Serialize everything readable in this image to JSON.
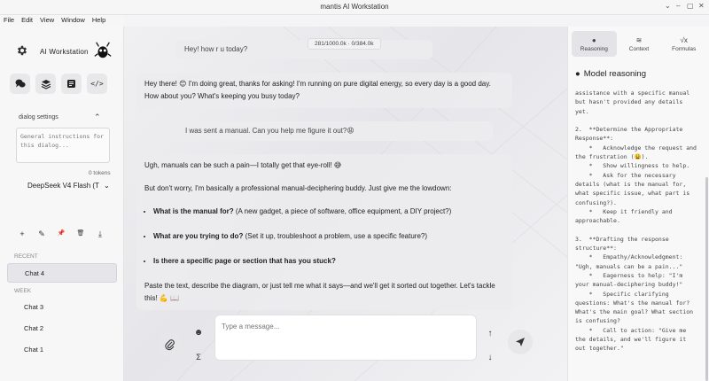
{
  "window": {
    "title": "mantis AI Workstation",
    "controls": [
      "⌄",
      "–",
      "▢",
      "✕"
    ]
  },
  "menu": [
    "File",
    "Edit",
    "View",
    "Window",
    "Help"
  ],
  "sidebar": {
    "brand": "AI Workstation",
    "mode_buttons": [
      {
        "name": "chat-mode-button",
        "glyph": "💬"
      },
      {
        "name": "layers-mode-button",
        "glyph": "≋"
      },
      {
        "name": "notes-mode-button",
        "glyph": "▤"
      },
      {
        "name": "code-mode-button",
        "glyph": "</>"
      }
    ],
    "dialog_settings_label": "dialog settings",
    "instructions_placeholder": "General instructions for this dialog...",
    "tokens": "0 tokens",
    "model": "DeepSeek V4 Flash (T",
    "actions": [
      "+",
      "✎",
      "📌",
      "🗑",
      "⤓"
    ],
    "recent_label": "RECENT",
    "week_label": "WEEK",
    "recent_chats": [
      "Chat 4"
    ],
    "week_chats": [
      "Chat 3",
      "Chat 2",
      "Chat 1"
    ]
  },
  "conversation": {
    "token_counter": "281/1000.0k · 0/384.0k",
    "user1": "Hey! how r u today?",
    "assist1": "Hey there! 😊 I'm doing great, thanks for asking! I'm running on pure digital energy, so every day is a good day. How about you? What's keeping you busy today?",
    "user2": "I was sent a manual. Can you help me figure it out?😩",
    "assist2": {
      "p1": "Ugh, manuals can be such a pain—I totally get that eye-roll! 😅",
      "p2": "But don't worry, I'm basically a professional manual-deciphering buddy. Just give me the lowdown:",
      "bullets": [
        {
          "bold": "What is the manual for?",
          "rest": " (A new gadget, a piece of software, office equipment, a DIY project?)"
        },
        {
          "bold": "What are you trying to do?",
          "rest": " (Set it up, troubleshoot a problem, use a specific feature?)"
        },
        {
          "bold": "Is there a specific page or section that has you stuck?",
          "rest": ""
        }
      ],
      "p3": "Paste the text, describe the diagram, or just tell me what it says—and we'll get it sorted out together. Let's tackle this! 💪 📖"
    }
  },
  "composer": {
    "placeholder": "Type a message..."
  },
  "right_panel": {
    "tabs": [
      {
        "label": "Reasoning",
        "glyph": "🧠",
        "active": true
      },
      {
        "label": "Context",
        "glyph": "≋",
        "active": false
      },
      {
        "label": "Formulas",
        "glyph": "√x",
        "active": false
      }
    ],
    "header": "Model reasoning",
    "reasoning_text": "assistance with a specific manual\nbut hasn't provided any details\nyet.\n\n2.  **Determine the Appropriate\nResponse**:\n    *   Acknowledge the request and\nthe frustration (😩).\n    *   Show willingness to help.\n    *   Ask for the necessary\ndetails (what is the manual for,\nwhat specific issue, what part is\nconfusing?).\n    *   Keep it friendly and\napproachable.\n\n3.  **Drafting the response\nstructure**:\n    *   Empathy/Acknowledgment:\n\"Ugh, manuals can be a pain...\"\n    *   Eagerness to help: \"I'm\nyour manual-deciphering buddy!\"\n    *   Specific clarifying\nquestions: What's the manual for?\nWhat's the main goal? What section\nis confusing?\n    *   Call to action: \"Give me\nthe details, and we'll figure it\nout together.\""
  }
}
